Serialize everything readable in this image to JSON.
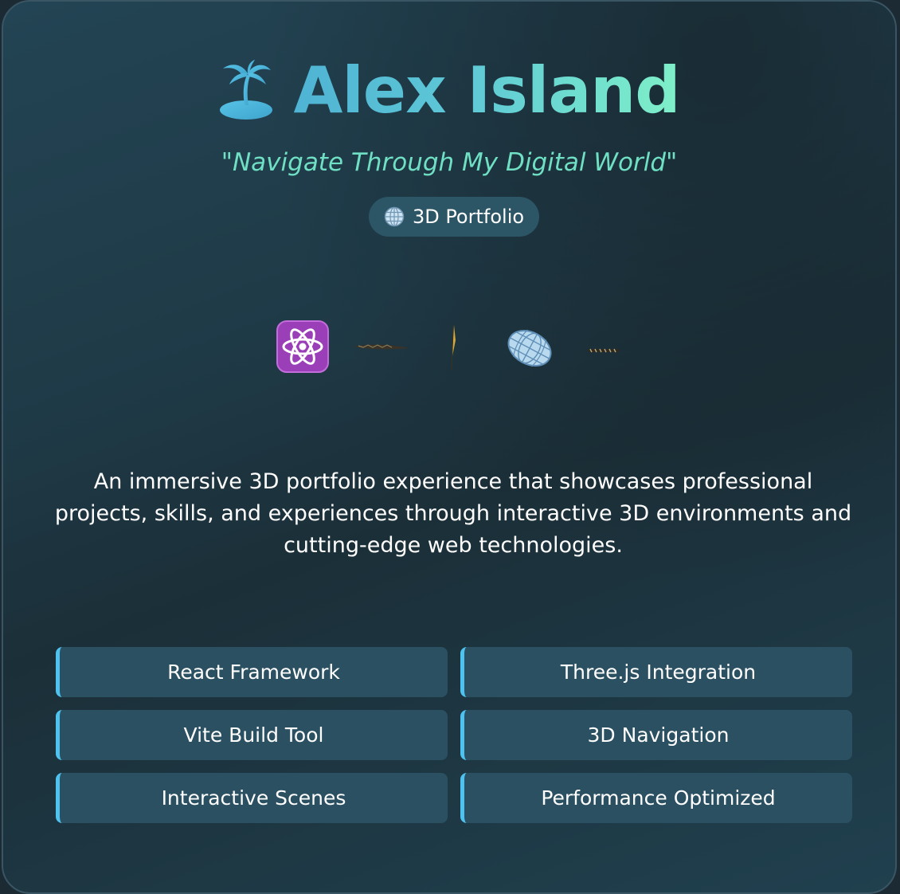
{
  "header": {
    "icon": "desert-island-icon",
    "title": "Alex Island",
    "tagline": "\"Navigate Through My Digital World\""
  },
  "badge": {
    "icon": "globe-icon",
    "label": "3D Portfolio"
  },
  "tech_icons": [
    "atom-icon",
    "rotating-shape-icon",
    "rotating-shape-icon",
    "globe-mesh-icon",
    "rotating-shape-icon"
  ],
  "description": "An immersive 3D portfolio experience that showcases professional projects, skills, and experiences through interactive 3D environments and cutting-edge web technologies.",
  "features": [
    "React Framework",
    "Three.js Integration",
    "Vite Build Tool",
    "3D Navigation",
    "Interactive Scenes",
    "Performance Optimized"
  ],
  "colors": {
    "accent": "#4fc3f0",
    "title_gradient_start": "#4fb3d4",
    "title_gradient_end": "#7ff0c8",
    "tagline": "#6fe0c4",
    "card_bg": "#234454"
  }
}
